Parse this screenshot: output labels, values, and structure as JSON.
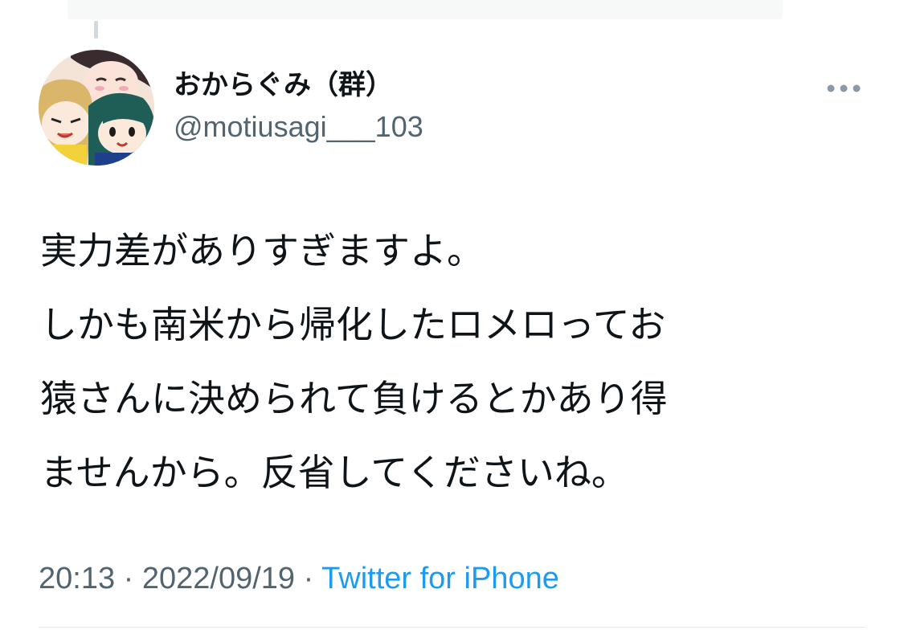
{
  "tweet": {
    "author": {
      "display_name": "おからぐみ（群）",
      "handle": "@motiusagi___103",
      "avatar_icon": "avatar-illustration"
    },
    "more_icon": "more-horizontal-icon",
    "text_lines": [
      "実力差がありすぎますよ。",
      "しかも南米から帰化したロメロってお",
      "猿さんに決められて負けるとかあり得",
      "ませんから。反省してくださいね。"
    ],
    "time": "20:13",
    "separator": "·",
    "date": "2022/09/19",
    "source": "Twitter for iPhone"
  },
  "colors": {
    "primary_text": "#0f1419",
    "secondary_text": "#536471",
    "link": "#1d9bf0",
    "divider": "#e5e8eb"
  }
}
